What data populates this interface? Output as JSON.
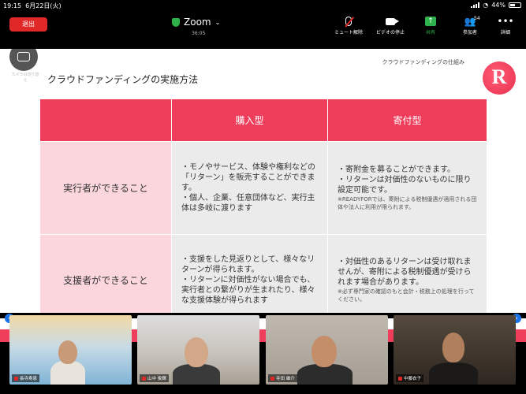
{
  "status_bar": {
    "time": "19:15",
    "date": "6月22日(火)",
    "battery": "44%"
  },
  "topbar": {
    "leave_label": "退出",
    "app_title": "Zoom",
    "timer": "36:05",
    "tools": [
      {
        "icon": "mic-muted-icon",
        "label": "ミュート解除"
      },
      {
        "icon": "video-camera-icon",
        "label": "ビデオの停止"
      },
      {
        "icon": "share-screen-icon",
        "label": "共有"
      },
      {
        "icon": "participants-icon",
        "label": "参加者",
        "count": "54"
      },
      {
        "icon": "more-icon",
        "label": "詳細"
      }
    ]
  },
  "camera_switch": {
    "label": "カメラの切り替え"
  },
  "slide": {
    "header": "クラウドファンディングの仕組み",
    "logo_letter": "R",
    "title": "クラウドファンディングの実施方法",
    "columns": [
      "",
      "購入型",
      "寄付型"
    ],
    "rows": [
      {
        "head": "実行者ができること",
        "purchase": "・モノやサービス、体験や権利などの「リターン」を販売することができます。\n・個人、企業、任意団体など、実行主体は多岐に渡ります",
        "donation": "・寄附金を募ることができます。\n・リターンは対価性のないものに限り設定可能です。",
        "donation_note": "※READYFORでは、寄附による税制優遇が適用される団体や法人に利用が限られます。"
      },
      {
        "head": "支援者ができること",
        "purchase": "・支援をした見返りとして、様々なリターンが得られます。\n・リターンに対価性がない場合でも、実行者との繋がりが生まれたり、様々な支援体験が得られます",
        "donation": "・対価性のあるリターンは受け取れませんが、寄附による税制優遇が受けられます場合があります。",
        "donation_note": "※必ず専門家の確認のもと会計・税務上の処理を行ってください。"
      }
    ]
  },
  "gallery": {
    "tiles": [
      {
        "name": "長寺寿恵"
      },
      {
        "name": "山中 俊輝"
      },
      {
        "name": "寺田 雄介"
      },
      {
        "name": "中藤衣子"
      }
    ]
  },
  "colors": {
    "brand_red": "#ef3d5c",
    "leave_red": "#e02828",
    "share_green": "#2fb24a",
    "row_pink": "#fbd6dd",
    "cell_gray": "#ebebeb"
  }
}
